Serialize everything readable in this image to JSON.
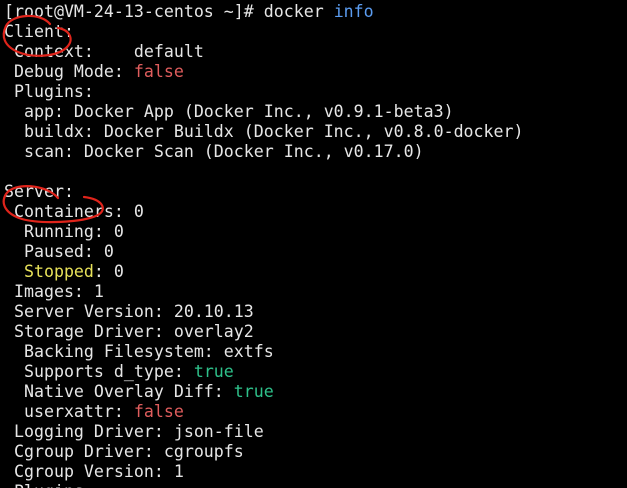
{
  "terminal": {
    "lines": [
      [
        {
          "t": "[root@VM-24-13-centos ~]# docker ",
          "c": "white"
        },
        {
          "t": "info",
          "c": "blue"
        }
      ],
      [
        {
          "t": "Client:",
          "c": "white"
        }
      ],
      [
        {
          "t": " Context:    default",
          "c": "white"
        }
      ],
      [
        {
          "t": " Debug Mode: ",
          "c": "white"
        },
        {
          "t": "false",
          "c": "red"
        }
      ],
      [
        {
          "t": " Plugins:",
          "c": "white"
        }
      ],
      [
        {
          "t": "  app: Docker App (Docker Inc., v0.9.1-beta3)",
          "c": "white"
        }
      ],
      [
        {
          "t": "  buildx: Docker Buildx (Docker Inc., v0.8.0-docker)",
          "c": "white"
        }
      ],
      [
        {
          "t": "  scan: Docker Scan (Docker Inc., v0.17.0)",
          "c": "white"
        }
      ],
      [
        {
          "t": "",
          "c": "white"
        }
      ],
      [
        {
          "t": "Server:",
          "c": "white"
        }
      ],
      [
        {
          "t": " Containers: 0",
          "c": "white"
        }
      ],
      [
        {
          "t": "  Running: 0",
          "c": "white"
        }
      ],
      [
        {
          "t": "  Paused: 0",
          "c": "white"
        }
      ],
      [
        {
          "t": "  Stopped",
          "c": "yellow"
        },
        {
          "t": ": 0",
          "c": "white"
        }
      ],
      [
        {
          "t": " Images: 1",
          "c": "white"
        }
      ],
      [
        {
          "t": " Server Version: 20.10.13",
          "c": "white"
        }
      ],
      [
        {
          "t": " Storage Driver: overlay2",
          "c": "white"
        }
      ],
      [
        {
          "t": "  Backing Filesystem: extfs",
          "c": "white"
        }
      ],
      [
        {
          "t": "  Supports d_type: ",
          "c": "white"
        },
        {
          "t": "true",
          "c": "green"
        }
      ],
      [
        {
          "t": "  Native Overlay Diff: ",
          "c": "white"
        },
        {
          "t": "true",
          "c": "green"
        }
      ],
      [
        {
          "t": "  userxattr: ",
          "c": "white"
        },
        {
          "t": "false",
          "c": "red"
        }
      ],
      [
        {
          "t": " Logging Driver: json-file",
          "c": "white"
        }
      ],
      [
        {
          "t": " Cgroup Driver: cgroupfs",
          "c": "white"
        }
      ],
      [
        {
          "t": " Cgroup Version: 1",
          "c": "white"
        }
      ],
      [
        {
          "t": " Plugins:",
          "c": "white"
        }
      ]
    ]
  },
  "annotations": [
    {
      "name": "client-circle-annotation",
      "color": "#e0241b"
    },
    {
      "name": "server-circle-annotation",
      "color": "#e0241b"
    }
  ]
}
